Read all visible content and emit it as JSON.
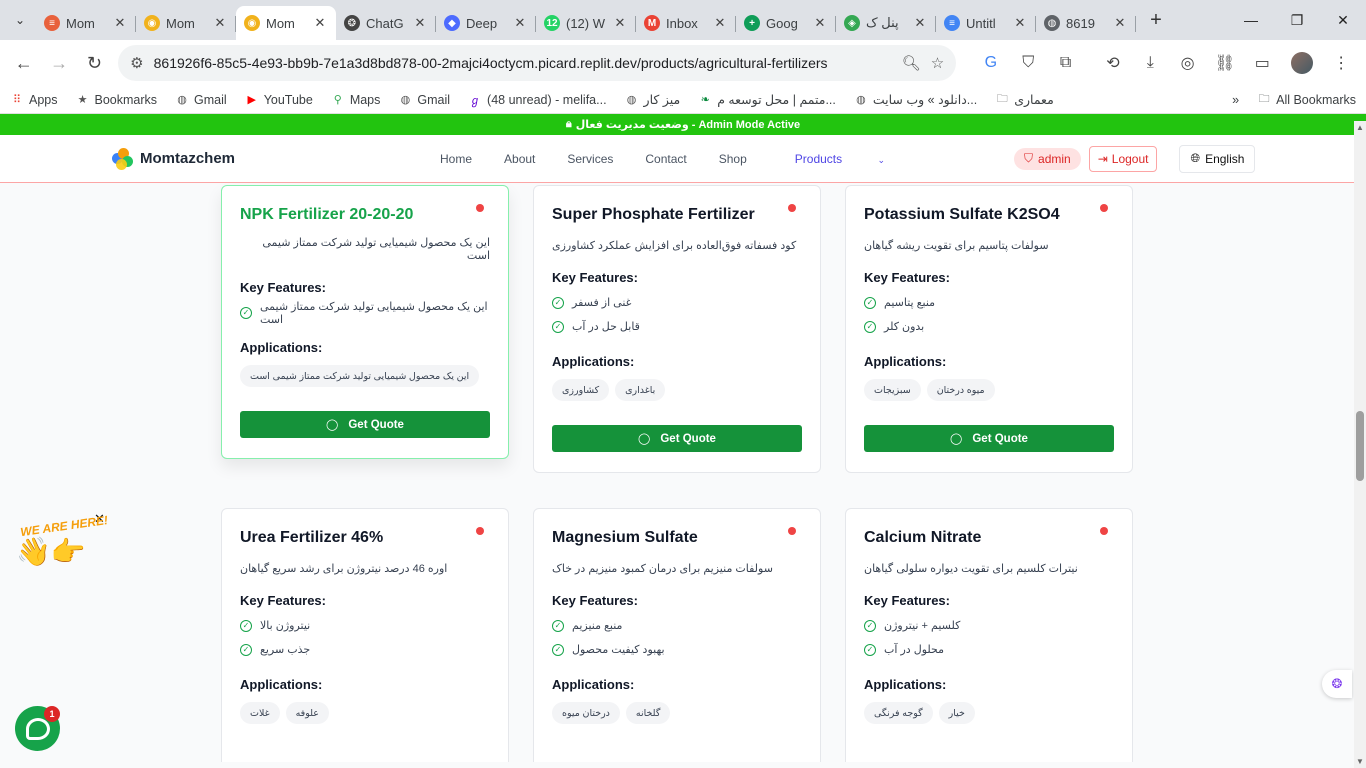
{
  "browser": {
    "tabs": [
      {
        "title": "Mom",
        "favicon_color": "#e8613c",
        "favicon_glyph": "≡",
        "active": false
      },
      {
        "title": "Mom",
        "favicon_color": "#f1b21c",
        "favicon_glyph": "◉",
        "active": false
      },
      {
        "title": "Mom",
        "favicon_color": "#f1b21c",
        "favicon_glyph": "◉",
        "active": true
      },
      {
        "title": "ChatG",
        "favicon_color": "#444444",
        "favicon_glyph": "❂",
        "active": false
      },
      {
        "title": "Deep",
        "favicon_color": "#4d6bfe",
        "favicon_glyph": "◆",
        "active": false
      },
      {
        "title": "(12) W",
        "favicon_color": "#25d366",
        "favicon_glyph": "12",
        "active": false
      },
      {
        "title": "Inbox",
        "favicon_color": "#ea4335",
        "favicon_glyph": "M",
        "active": false
      },
      {
        "title": "Goog",
        "favicon_color": "#0f9d58",
        "favicon_glyph": "+",
        "active": false
      },
      {
        "title": "پنل ک",
        "favicon_color": "#34a853",
        "favicon_glyph": "◈",
        "active": false
      },
      {
        "title": "Untitl",
        "favicon_color": "#4285f4",
        "favicon_glyph": "≡",
        "active": false
      },
      {
        "title": "8619",
        "favicon_color": "#5f6368",
        "favicon_glyph": "◍",
        "active": false
      }
    ],
    "url": "861926f6-85c5-4e93-bb9b-7e1a3d8bd878-00-2majci4octycm.picard.replit.dev/products/agricultural-fertilizers",
    "bookmarks": [
      {
        "label": "Apps",
        "icon": "apps-grid-icon"
      },
      {
        "label": "Bookmarks",
        "icon": "star-icon"
      },
      {
        "label": "Gmail",
        "icon": "globe-icon"
      },
      {
        "label": "YouTube",
        "icon": "youtube-icon"
      },
      {
        "label": "Maps",
        "icon": "maps-pin-icon"
      },
      {
        "label": "Gmail",
        "icon": "globe-icon"
      },
      {
        "label": "(48 unread) - melifa...",
        "icon": "yahoo-icon"
      },
      {
        "label": "میز کار",
        "icon": "globe-icon"
      },
      {
        "label": "متمم | محل توسعه م...",
        "icon": "motamem-icon"
      },
      {
        "label": "دانلود » وب سایت...",
        "icon": "globe-icon"
      },
      {
        "label": "معماری",
        "icon": "folder-icon"
      }
    ],
    "all_bookmarks_label": "All Bookmarks"
  },
  "site": {
    "admin_banner": "وضعیت مدیریت فعال - Admin Mode Active",
    "brand": "Momtazchem",
    "nav": [
      "Home",
      "About",
      "Services",
      "Contact",
      "Shop",
      "Products"
    ],
    "admin_label": "admin",
    "logout_label": "Logout",
    "language_label": "English"
  },
  "products": [
    {
      "name": "NPK Fertilizer 20-20-20",
      "description": "این یک محصول شیمیایی تولید شرکت ممتاز شیمی است",
      "features_title": "Key Features:",
      "features": [
        "این یک محصول شیمیایی تولید شرکت ممتاز شیمی است"
      ],
      "applications_title": "Applications:",
      "applications": [
        "این یک محصول شیمیایی تولید شرکت ممتاز شیمی است"
      ],
      "button": "Get Quote"
    },
    {
      "name": "Super Phosphate Fertilizer",
      "description": "کود فسفاته فوق‌العاده برای افزایش عملکرد کشاورزی",
      "features_title": "Key Features:",
      "features": [
        "غنی از فسفر",
        "قابل حل در آب"
      ],
      "applications_title": "Applications:",
      "applications": [
        "کشاورزی",
        "باغداری"
      ],
      "button": "Get Quote"
    },
    {
      "name": "Potassium Sulfate K2SO4",
      "description": "سولفات پتاسیم برای تقویت ریشه گیاهان",
      "features_title": "Key Features:",
      "features": [
        "منبع پتاسیم",
        "بدون کلر"
      ],
      "applications_title": "Applications:",
      "applications": [
        "سبزیجات",
        "میوه درختان"
      ],
      "button": "Get Quote"
    },
    {
      "name": "Urea Fertilizer 46%",
      "description": "اوره 46 درصد نیتروژن برای رشد سریع گیاهان",
      "features_title": "Key Features:",
      "features": [
        "نیتروژن بالا",
        "جذب سریع"
      ],
      "applications_title": "Applications:",
      "applications": [
        "غلات",
        "علوفه"
      ]
    },
    {
      "name": "Magnesium Sulfate",
      "description": "سولفات منیزیم برای درمان کمبود منیزیم در خاک",
      "features_title": "Key Features:",
      "features": [
        "منبع منیزیم",
        "بهبود کیفیت محصول"
      ],
      "applications_title": "Applications:",
      "applications": [
        "درختان میوه",
        "گلخانه"
      ]
    },
    {
      "name": "Calcium Nitrate",
      "description": "نیترات کلسیم برای تقویت دیواره سلولی گیاهان",
      "features_title": "Key Features:",
      "features": [
        "کلسیم + نیتروژن",
        "محلول در آب"
      ],
      "applications_title": "Applications:",
      "applications": [
        "گوجه فرنگی",
        "خیار"
      ]
    }
  ],
  "widgets": {
    "we_are_here": "WE ARE HERE!",
    "chat_badge": "1"
  }
}
